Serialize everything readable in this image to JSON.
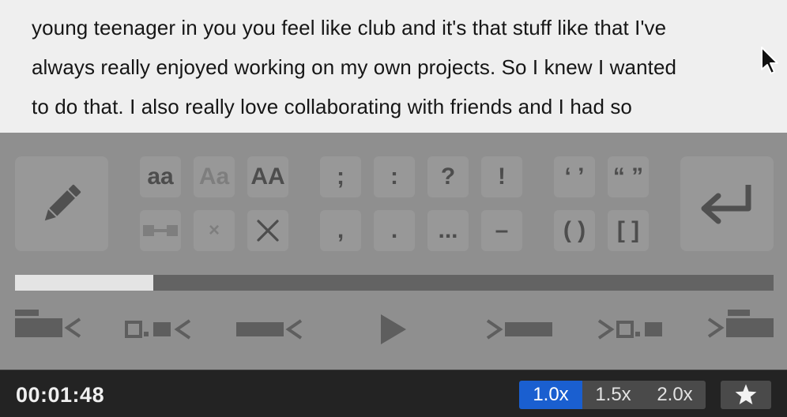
{
  "transcript": {
    "lines": [
      "young teenager in you you feel like club and it's that stuff like that I've",
      "always really enjoyed working on my own projects. So I knew I wanted",
      "to do that. I also really love collaborating with friends and I had so"
    ]
  },
  "toolbar": {
    "case": {
      "lower": "aa",
      "title": "Aa",
      "upper": "AA"
    },
    "delete_small": "×",
    "punctuation": {
      "semicolon": ";",
      "colon": ":",
      "question": "?",
      "exclamation": "!",
      "comma": ",",
      "period": ".",
      "ellipsis": "...",
      "dash": "–",
      "single_quotes": "‘ ’",
      "double_quotes": "“ ”",
      "parens": "( )",
      "brackets": "[ ]"
    }
  },
  "progress": {
    "fraction": 0.182
  },
  "status": {
    "time": "00:01:48",
    "speeds": [
      "1.0x",
      "1.5x",
      "2.0x"
    ],
    "active_speed": "1.0x"
  },
  "icons": {
    "edit": "pencil-icon",
    "enter": "return-arrow-icon",
    "merge": "merge-icon",
    "delete": "x-icon",
    "favorite": "star-icon",
    "play": "play-icon"
  },
  "colors": {
    "accent": "#1a5fd0",
    "panel": "#8f8f8f",
    "status_bar": "#232323"
  }
}
